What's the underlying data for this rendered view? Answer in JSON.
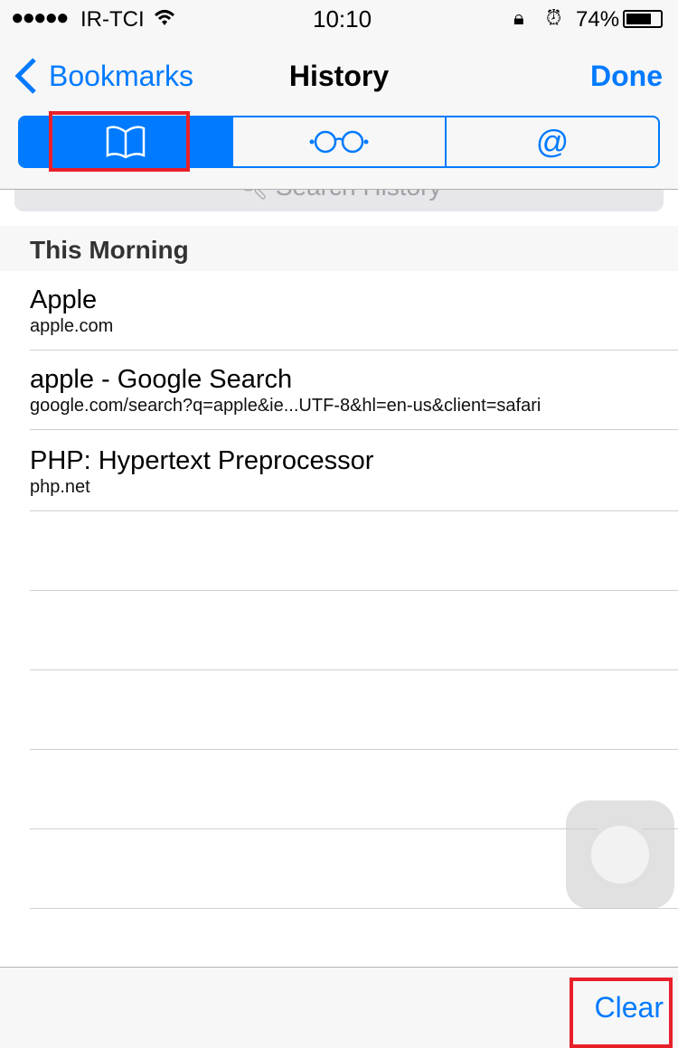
{
  "status": {
    "carrier": "IR-TCI",
    "time": "10:10",
    "battery": "74%"
  },
  "nav": {
    "back_label": "Bookmarks",
    "title": "History",
    "done_label": "Done"
  },
  "segments": [
    {
      "icon": "book-icon",
      "selected": true
    },
    {
      "icon": "glasses-icon",
      "selected": false
    },
    {
      "icon": "at-icon",
      "label": "@",
      "selected": false
    }
  ],
  "search": {
    "placeholder": "Search History"
  },
  "section": {
    "title": "This Morning"
  },
  "items": [
    {
      "title": "Apple",
      "url": "apple.com"
    },
    {
      "title": "apple - Google Search",
      "url": "google.com/search?q=apple&ie...UTF-8&hl=en-us&client=safari"
    },
    {
      "title": "PHP: Hypertext Preprocessor",
      "url": "php.net"
    }
  ],
  "toolbar": {
    "clear_label": "Clear"
  },
  "colors": {
    "accent": "#007aff",
    "highlight": "#e8202a"
  }
}
